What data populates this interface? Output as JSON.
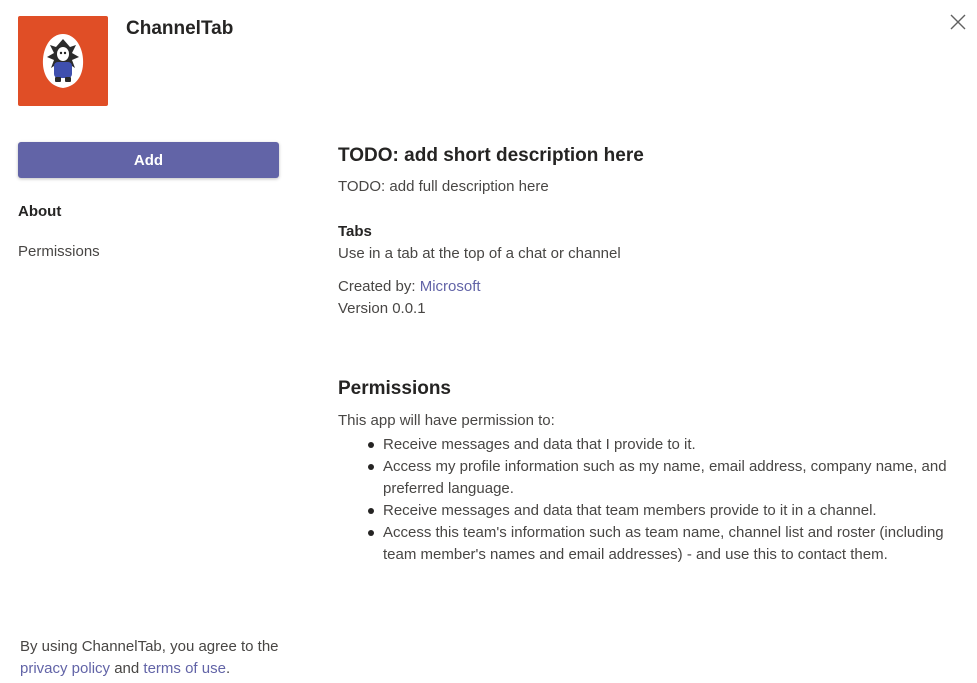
{
  "app": {
    "name": "ChannelTab",
    "icon": "app-logo-icon",
    "icon_bg": "#e04e26",
    "accent": "#6264a7"
  },
  "header": {
    "close_icon": "close-icon"
  },
  "sidebar": {
    "add_label": "Add",
    "nav": [
      {
        "label": "About"
      },
      {
        "label": "Permissions"
      }
    ]
  },
  "about": {
    "short_description": "TODO: add short description here",
    "full_description": "TODO: add full description here",
    "tabs_heading": "Tabs",
    "tabs_description": "Use in a tab at the top of a chat or channel",
    "created_by_label": "Created by:",
    "developer": "Microsoft",
    "version": "Version 0.0.1"
  },
  "permissions": {
    "heading": "Permissions",
    "intro": "This app will have permission to:",
    "items": [
      "Receive messages and data that I provide to it.",
      "Access my profile information such as my name, email address, company name, and preferred language.",
      "Receive messages and data that team members provide to it in a channel.",
      "Access this team's information such as team name, channel list and roster (including team member's names and email addresses) - and use this to contact them."
    ]
  },
  "footer": {
    "prefix": "By using ChannelTab, you agree to the",
    "privacy_link": "privacy policy",
    "and": "and",
    "terms_link": "terms of use",
    "suffix": "."
  }
}
